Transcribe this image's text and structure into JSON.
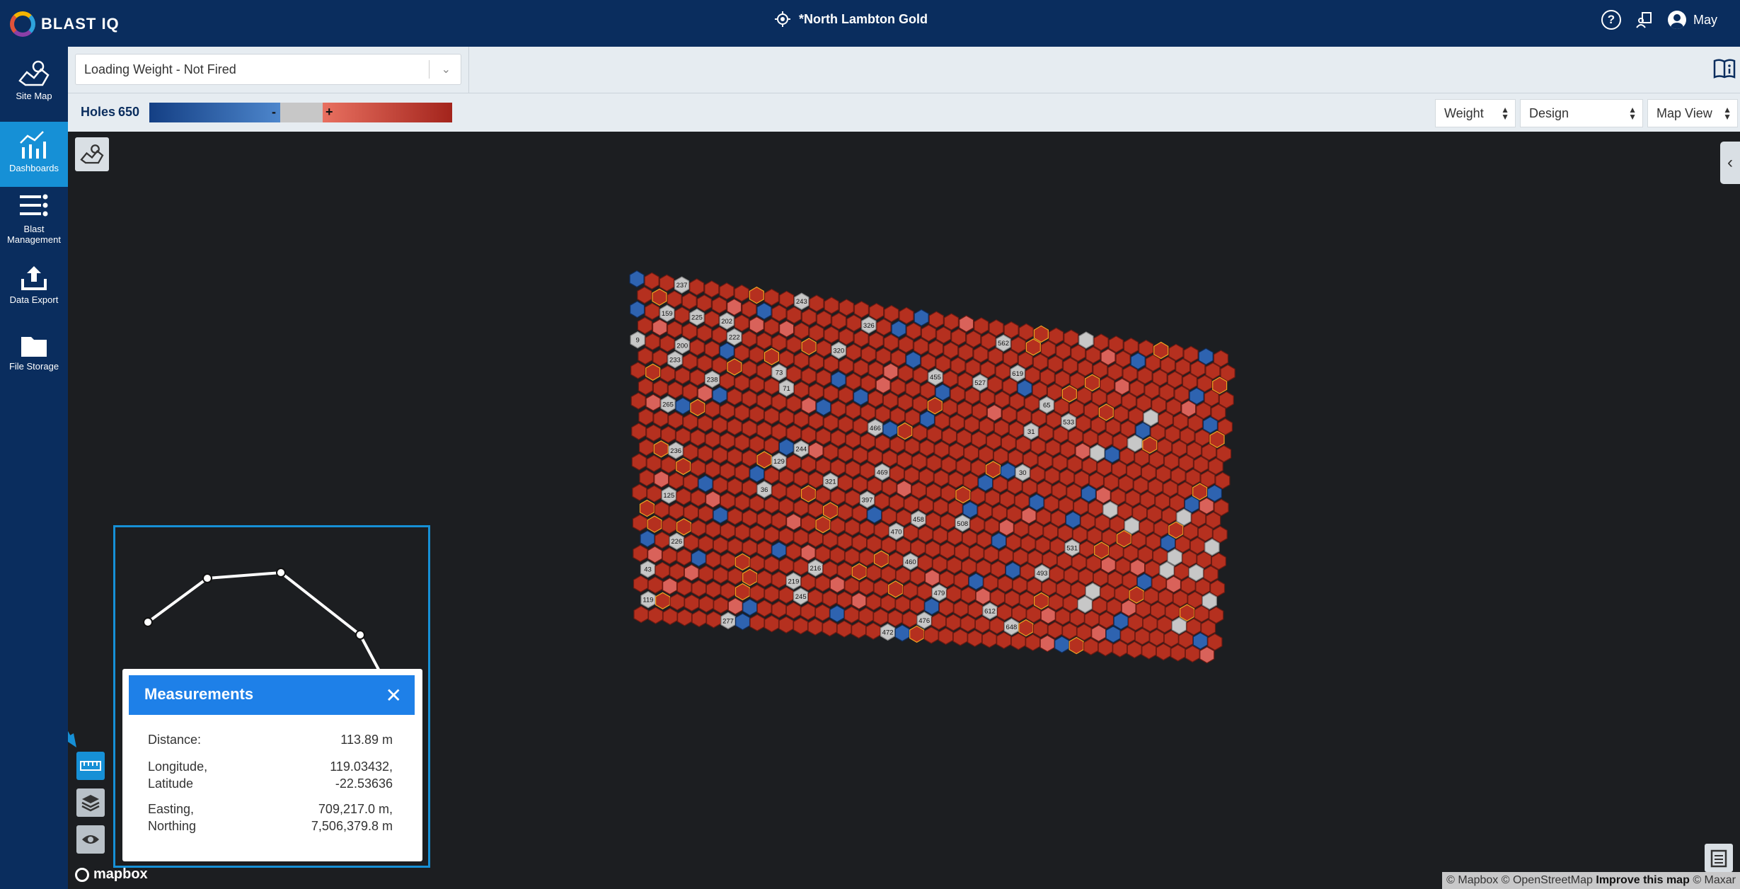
{
  "app": {
    "brand": "BLAST IQ",
    "site_title": "*North Lambton Gold",
    "user_name": "May"
  },
  "header_icons": {
    "help": "help-icon",
    "report": "report-icon",
    "user": "user-icon",
    "site": "crosshair-icon"
  },
  "sidebar": {
    "items": [
      {
        "label": "Site Map",
        "icon": "site-map-icon"
      },
      {
        "label": "Dashboards",
        "icon": "dashboard-icon",
        "active": true
      },
      {
        "label": "Blast Management",
        "icon": "blast-management-icon"
      },
      {
        "label": "Data Export",
        "icon": "export-icon"
      },
      {
        "label": "File Storage",
        "icon": "folder-icon"
      }
    ]
  },
  "toolbar": {
    "dashboard_select": "Loading Weight - Not Fired"
  },
  "legend": {
    "holes_label": "Holes",
    "holes_count": "650",
    "minus": "-",
    "plus": "+",
    "colors": {
      "negative": "#2e63b0",
      "neutral": "#c7c7c7",
      "positive": "#b5301f"
    }
  },
  "view_controls": {
    "metric": "Weight",
    "mode": "Design",
    "view": "Map View"
  },
  "measurements": {
    "title": "Measurements",
    "distance_label": "Distance:",
    "distance_value": "113.89 m",
    "lonlat_label_1": "Longitude,",
    "lonlat_label_2": "Latitude",
    "lon_value": "119.03432,",
    "lat_value": "-22.53636",
    "en_label_1": "Easting,",
    "en_label_2": "Northing",
    "easting_value": "709,217.0 m,",
    "northing_value": "7,506,379.8 m"
  },
  "map_footer": {
    "mapbox": "mapbox",
    "attribution": "© Mapbox © OpenStreetMap",
    "improve": "Improve this map",
    "maxar": "© Maxar"
  },
  "hole_labels": [
    "9",
    "43",
    "119",
    "159",
    "233",
    "265",
    "236",
    "125",
    "226",
    "237",
    "200",
    "225",
    "238",
    "202",
    "222",
    "277",
    "36",
    "73",
    "129",
    "71",
    "219",
    "243",
    "244",
    "245",
    "216",
    "320",
    "321",
    "326",
    "397",
    "466",
    "469",
    "470",
    "472",
    "460",
    "458",
    "476",
    "455",
    "479",
    "508",
    "527",
    "562",
    "612",
    "619",
    "648",
    "31",
    "30",
    "65",
    "493",
    "533",
    "531"
  ]
}
